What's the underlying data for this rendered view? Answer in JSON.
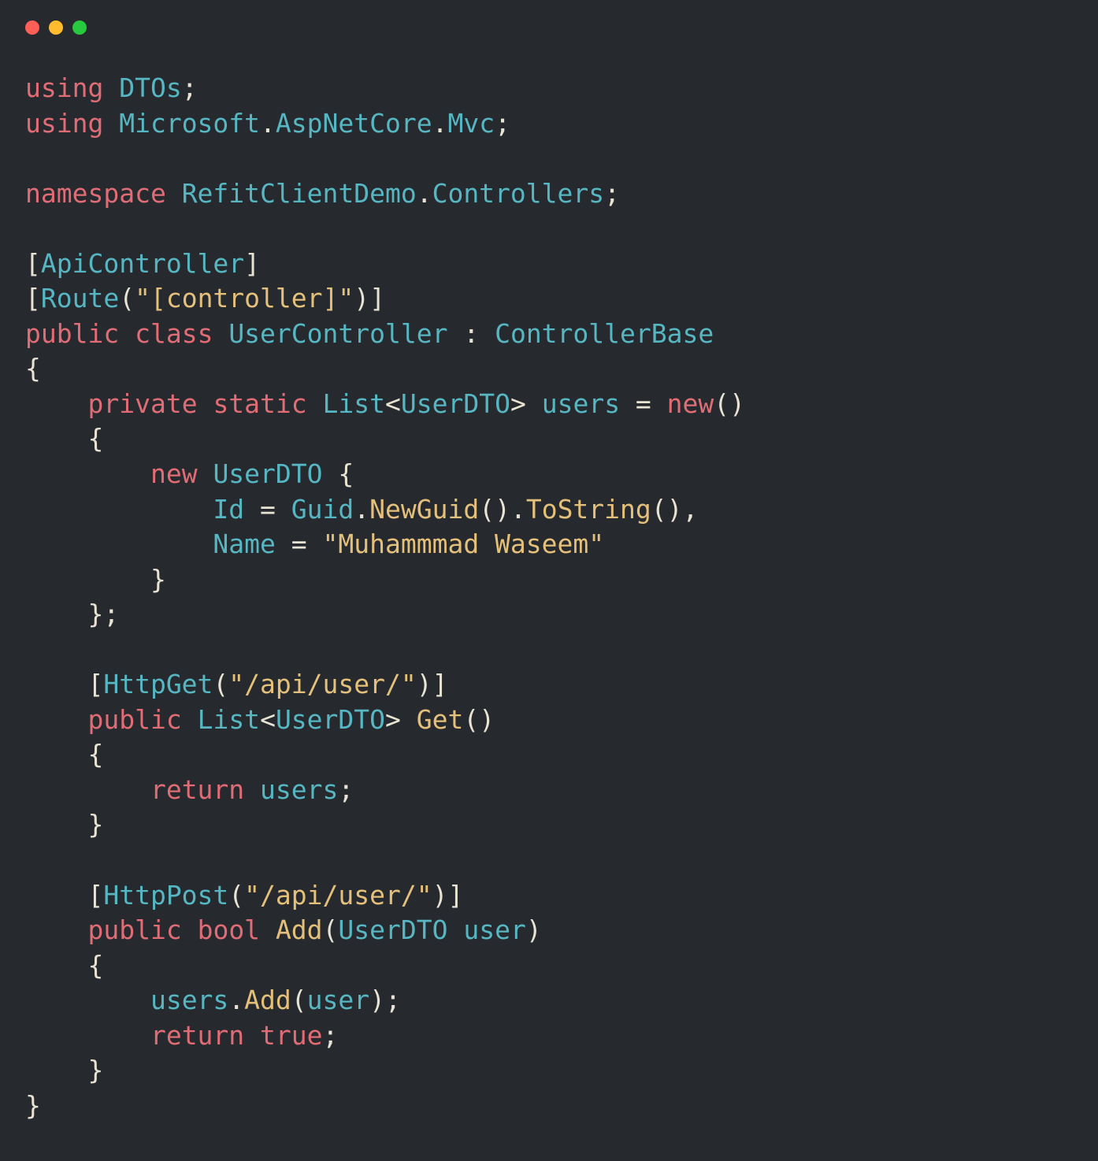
{
  "titlebar": {
    "red": "close",
    "yellow": "minimize",
    "green": "maximize"
  },
  "code": {
    "tokens": [
      [
        [
          "kw",
          "using"
        ],
        [
          "plain",
          " "
        ],
        [
          "type",
          "DTOs"
        ],
        [
          "plain",
          ";"
        ]
      ],
      [
        [
          "kw",
          "using"
        ],
        [
          "plain",
          " "
        ],
        [
          "type",
          "Microsoft"
        ],
        [
          "plain",
          "."
        ],
        [
          "type",
          "AspNetCore"
        ],
        [
          "plain",
          "."
        ],
        [
          "type",
          "Mvc"
        ],
        [
          "plain",
          ";"
        ]
      ],
      [],
      [
        [
          "kw",
          "namespace"
        ],
        [
          "plain",
          " "
        ],
        [
          "type",
          "RefitClientDemo"
        ],
        [
          "plain",
          "."
        ],
        [
          "type",
          "Controllers"
        ],
        [
          "plain",
          ";"
        ]
      ],
      [],
      [
        [
          "plain",
          "["
        ],
        [
          "type",
          "ApiController"
        ],
        [
          "plain",
          "]"
        ]
      ],
      [
        [
          "plain",
          "["
        ],
        [
          "type",
          "Route"
        ],
        [
          "plain",
          "("
        ],
        [
          "str",
          "\"[controller]\""
        ],
        [
          "plain",
          ")]"
        ]
      ],
      [
        [
          "kw",
          "public"
        ],
        [
          "plain",
          " "
        ],
        [
          "kw",
          "class"
        ],
        [
          "plain",
          " "
        ],
        [
          "type",
          "UserController"
        ],
        [
          "plain",
          " : "
        ],
        [
          "type",
          "ControllerBase"
        ]
      ],
      [
        [
          "plain",
          "{"
        ]
      ],
      [
        [
          "plain",
          "    "
        ],
        [
          "kw",
          "private"
        ],
        [
          "plain",
          " "
        ],
        [
          "kw",
          "static"
        ],
        [
          "plain",
          " "
        ],
        [
          "type",
          "List"
        ],
        [
          "plain",
          "<"
        ],
        [
          "type",
          "UserDTO"
        ],
        [
          "plain",
          "> "
        ],
        [
          "ident",
          "users"
        ],
        [
          "plain",
          " = "
        ],
        [
          "kw",
          "new"
        ],
        [
          "plain",
          "()"
        ]
      ],
      [
        [
          "plain",
          "    {"
        ]
      ],
      [
        [
          "plain",
          "        "
        ],
        [
          "kw",
          "new"
        ],
        [
          "plain",
          " "
        ],
        [
          "type",
          "UserDTO"
        ],
        [
          "plain",
          " {"
        ]
      ],
      [
        [
          "plain",
          "            "
        ],
        [
          "ident",
          "Id"
        ],
        [
          "plain",
          " = "
        ],
        [
          "type",
          "Guid"
        ],
        [
          "plain",
          "."
        ],
        [
          "method",
          "NewGuid"
        ],
        [
          "plain",
          "()."
        ],
        [
          "method",
          "ToString"
        ],
        [
          "plain",
          "(),"
        ]
      ],
      [
        [
          "plain",
          "            "
        ],
        [
          "ident",
          "Name"
        ],
        [
          "plain",
          " = "
        ],
        [
          "str",
          "\"Muhammmad Waseem\""
        ]
      ],
      [
        [
          "plain",
          "        }"
        ]
      ],
      [
        [
          "plain",
          "    };"
        ]
      ],
      [],
      [
        [
          "plain",
          "    ["
        ],
        [
          "type",
          "HttpGet"
        ],
        [
          "plain",
          "("
        ],
        [
          "str",
          "\"/api/user/\""
        ],
        [
          "plain",
          ")]"
        ]
      ],
      [
        [
          "plain",
          "    "
        ],
        [
          "kw",
          "public"
        ],
        [
          "plain",
          " "
        ],
        [
          "type",
          "List"
        ],
        [
          "plain",
          "<"
        ],
        [
          "type",
          "UserDTO"
        ],
        [
          "plain",
          "> "
        ],
        [
          "method",
          "Get"
        ],
        [
          "plain",
          "()"
        ]
      ],
      [
        [
          "plain",
          "    {"
        ]
      ],
      [
        [
          "plain",
          "        "
        ],
        [
          "kw",
          "return"
        ],
        [
          "plain",
          " "
        ],
        [
          "ident",
          "users"
        ],
        [
          "plain",
          ";"
        ]
      ],
      [
        [
          "plain",
          "    }"
        ]
      ],
      [],
      [
        [
          "plain",
          "    ["
        ],
        [
          "type",
          "HttpPost"
        ],
        [
          "plain",
          "("
        ],
        [
          "str",
          "\"/api/user/\""
        ],
        [
          "plain",
          ")]"
        ]
      ],
      [
        [
          "plain",
          "    "
        ],
        [
          "kw",
          "public"
        ],
        [
          "plain",
          " "
        ],
        [
          "kw",
          "bool"
        ],
        [
          "plain",
          " "
        ],
        [
          "method",
          "Add"
        ],
        [
          "plain",
          "("
        ],
        [
          "type",
          "UserDTO"
        ],
        [
          "plain",
          " "
        ],
        [
          "ident",
          "user"
        ],
        [
          "plain",
          ")"
        ]
      ],
      [
        [
          "plain",
          "    {"
        ]
      ],
      [
        [
          "plain",
          "        "
        ],
        [
          "ident",
          "users"
        ],
        [
          "plain",
          "."
        ],
        [
          "method",
          "Add"
        ],
        [
          "plain",
          "("
        ],
        [
          "ident",
          "user"
        ],
        [
          "plain",
          ");"
        ]
      ],
      [
        [
          "plain",
          "        "
        ],
        [
          "kw",
          "return"
        ],
        [
          "plain",
          " "
        ],
        [
          "kw",
          "true"
        ],
        [
          "plain",
          ";"
        ]
      ],
      [
        [
          "plain",
          "    }"
        ]
      ],
      [
        [
          "plain",
          "}"
        ]
      ]
    ]
  }
}
